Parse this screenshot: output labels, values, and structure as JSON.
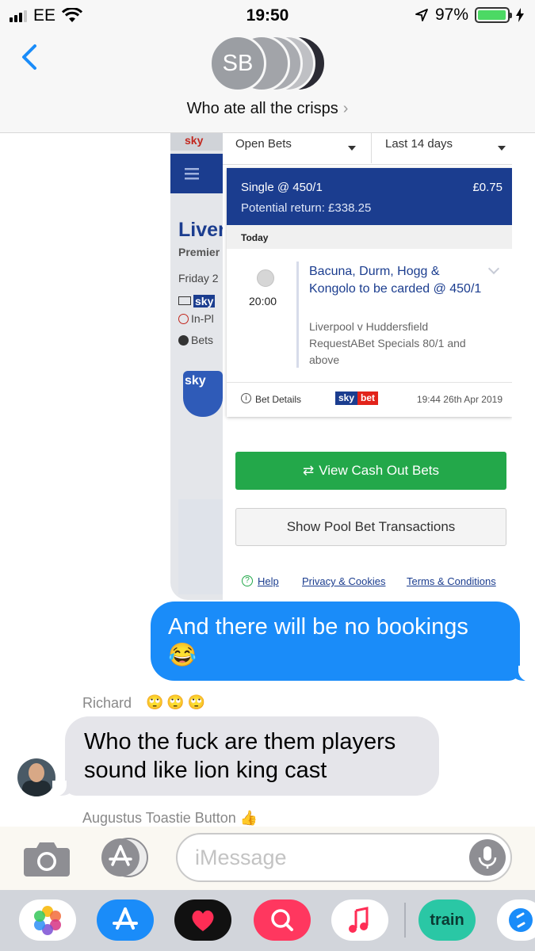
{
  "status_bar": {
    "carrier": "EE",
    "time": "19:50",
    "battery": "97%"
  },
  "conversation": {
    "avatar_initials": "SB",
    "title": "Who ate all the crisps",
    "title_chevron": "›"
  },
  "shared_image": {
    "filters": {
      "bets": "Open Bets",
      "period": "Last 14 days"
    },
    "bet": {
      "type": "Single @ 450/1",
      "stake": "£0.75",
      "potential_return": "Potential return: £338.25",
      "day_label": "Today",
      "time": "20:00",
      "selection": "Bacuna, Durm, Hogg & Kongolo to be carded @ 450/1",
      "event": "Liverpool v Huddersfield RequestABet Specials 80/1 and above",
      "details_label": "Bet Details",
      "logo_a": "sky",
      "logo_b": "bet",
      "timestamp": "19:44 26th Apr 2019"
    },
    "buttons": {
      "cash_out": "View Cash Out Bets",
      "pool": "Show Pool Bet Transactions"
    },
    "links": {
      "help": "Help",
      "privacy": "Privacy & Cookies",
      "terms": "Terms & Conditions"
    },
    "background_fragments": {
      "top_logo": "sky",
      "heading": "Liver",
      "sub": "Premier",
      "date": "Friday 2",
      "channel": "sky",
      "inplay": "In-Pl",
      "bets": "Bets",
      "club": "sky"
    }
  },
  "messages": [
    {
      "from": "me",
      "text": "And there will be no bookings 😂"
    },
    {
      "sender": "Richard",
      "sender_emojis": "🙄🙄🙄",
      "text": "Who the fuck are them players sound like lion king cast"
    }
  ],
  "next_sender": "Augustus Toastie Button",
  "next_sender_emoji": "👍",
  "input": {
    "placeholder": "iMessage"
  },
  "drawer_apps": [
    "photos-icon",
    "app-store-icon",
    "digital-touch-icon",
    "search-images-icon",
    "music-icon",
    "trainline-icon",
    "shazam-icon"
  ],
  "drawer_text": {
    "train": "train"
  },
  "colors": {
    "imessage_blue": "#1a8cf9",
    "sky_navy": "#1b3d8f",
    "cashout_green": "#23a84a",
    "battery_green": "#4cd964"
  }
}
